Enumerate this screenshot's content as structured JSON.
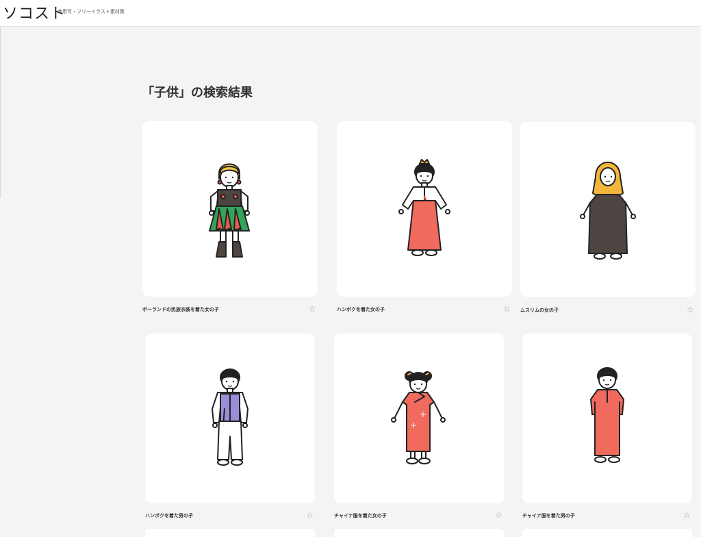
{
  "header": {
    "logo": "ソコスト",
    "tagline": "商用可・フリーイラスト素材集"
  },
  "page_title": "「子供」の検索結果",
  "results": [
    {
      "label": "ポーランドの民族衣装を着た女の子",
      "favorite_icon": "star-outline-icon"
    },
    {
      "label": "ハンボクを着た女の子",
      "favorite_icon": "star-outline-icon"
    },
    {
      "label": "ムスリムの女の子",
      "favorite_icon": "star-outline-icon"
    },
    {
      "label": "ハンボクを着た男の子",
      "favorite_icon": "star-outline-icon"
    },
    {
      "label": "チャイナ服を着た女の子",
      "favorite_icon": "star-outline-icon"
    },
    {
      "label": "チャイナ服を着た男の子",
      "favorite_icon": "star-outline-icon"
    }
  ],
  "star_glyph": "☆",
  "colors": {
    "background": "#f4f4f5",
    "card": "#ffffff",
    "outline": "#222222",
    "red": "#f06a5e",
    "green": "#33a35a",
    "purple": "#9b8dd6",
    "mustard": "#f2b63a",
    "dark_gray": "#4e4542"
  }
}
